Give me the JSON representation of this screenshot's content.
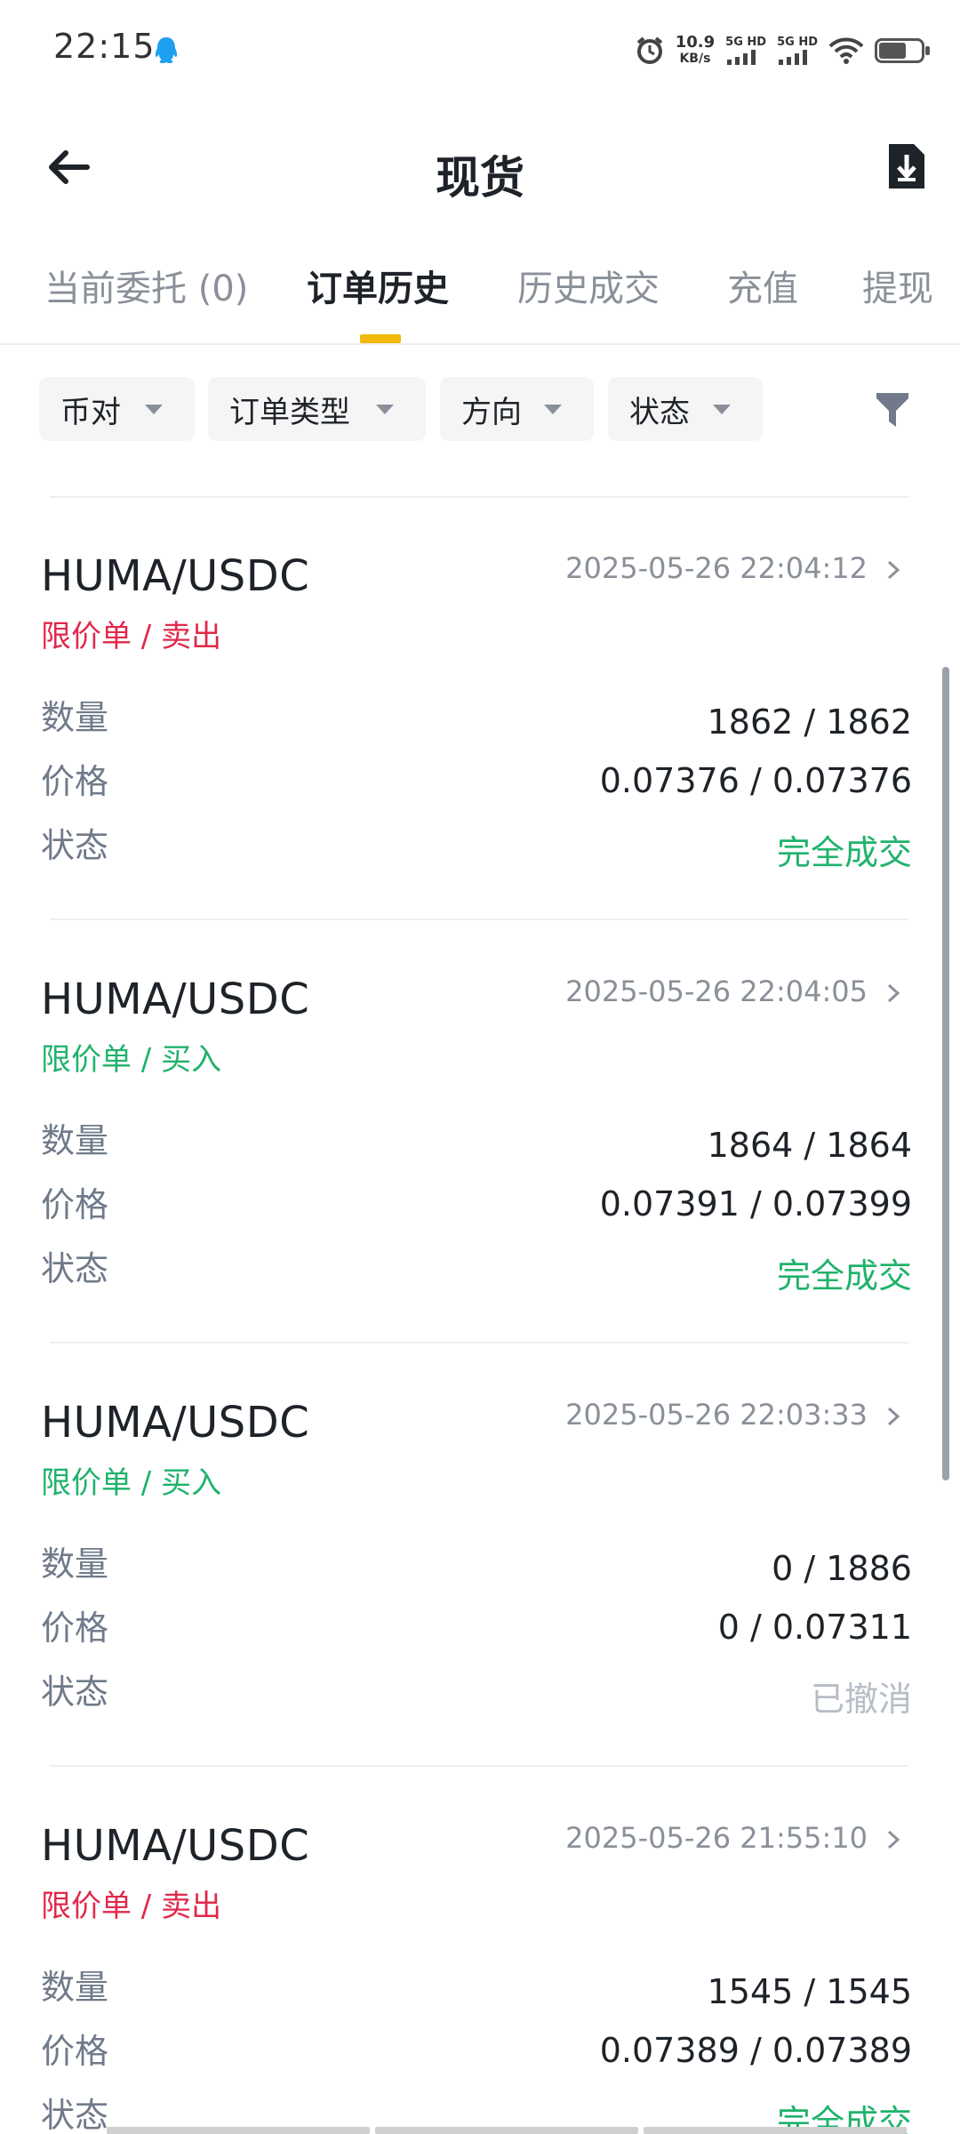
{
  "status_bar": {
    "time": "22:15",
    "speed_value": "10.9",
    "speed_unit": "KB/s",
    "sim1": "5G HD",
    "sim2": "5G HD"
  },
  "header": {
    "title": "现货"
  },
  "tabs": [
    {
      "label": "当前委托 (0)",
      "active": false
    },
    {
      "label": "订单历史",
      "active": true
    },
    {
      "label": "历史成交",
      "active": false
    },
    {
      "label": "充值",
      "active": false
    },
    {
      "label": "提现",
      "active": false
    }
  ],
  "filters": [
    {
      "label": "币对"
    },
    {
      "label": "订单类型"
    },
    {
      "label": "方向"
    },
    {
      "label": "状态"
    }
  ],
  "row_labels": {
    "quantity": "数量",
    "price": "价格",
    "status": "状态"
  },
  "orders": [
    {
      "pair": "HUMA/USDC",
      "type": "限价单 / 卖出",
      "side": "sell",
      "time": "2025-05-26 22:04:12",
      "quantity": "1862 / 1862",
      "price": "0.07376 / 0.07376",
      "status": "完全成交",
      "status_kind": "filled"
    },
    {
      "pair": "HUMA/USDC",
      "type": "限价单 / 买入",
      "side": "buy",
      "time": "2025-05-26 22:04:05",
      "quantity": "1864 / 1864",
      "price": "0.07391 / 0.07399",
      "status": "完全成交",
      "status_kind": "filled"
    },
    {
      "pair": "HUMA/USDC",
      "type": "限价单 / 买入",
      "side": "buy",
      "time": "2025-05-26 22:03:33",
      "quantity": "0 / 1886",
      "price": "0 / 0.07311",
      "status": "已撤消",
      "status_kind": "cancelled"
    },
    {
      "pair": "HUMA/USDC",
      "type": "限价单 / 卖出",
      "side": "sell",
      "time": "2025-05-26 21:55:10",
      "quantity": "1545 / 1545",
      "price": "0.07389 / 0.07389",
      "status": "完全成交",
      "status_kind": "filled"
    }
  ],
  "colors": {
    "accent": "#f0b90b",
    "sell": "#e0294a",
    "buy": "#20b26c",
    "cancelled": "#b7bdc6"
  }
}
